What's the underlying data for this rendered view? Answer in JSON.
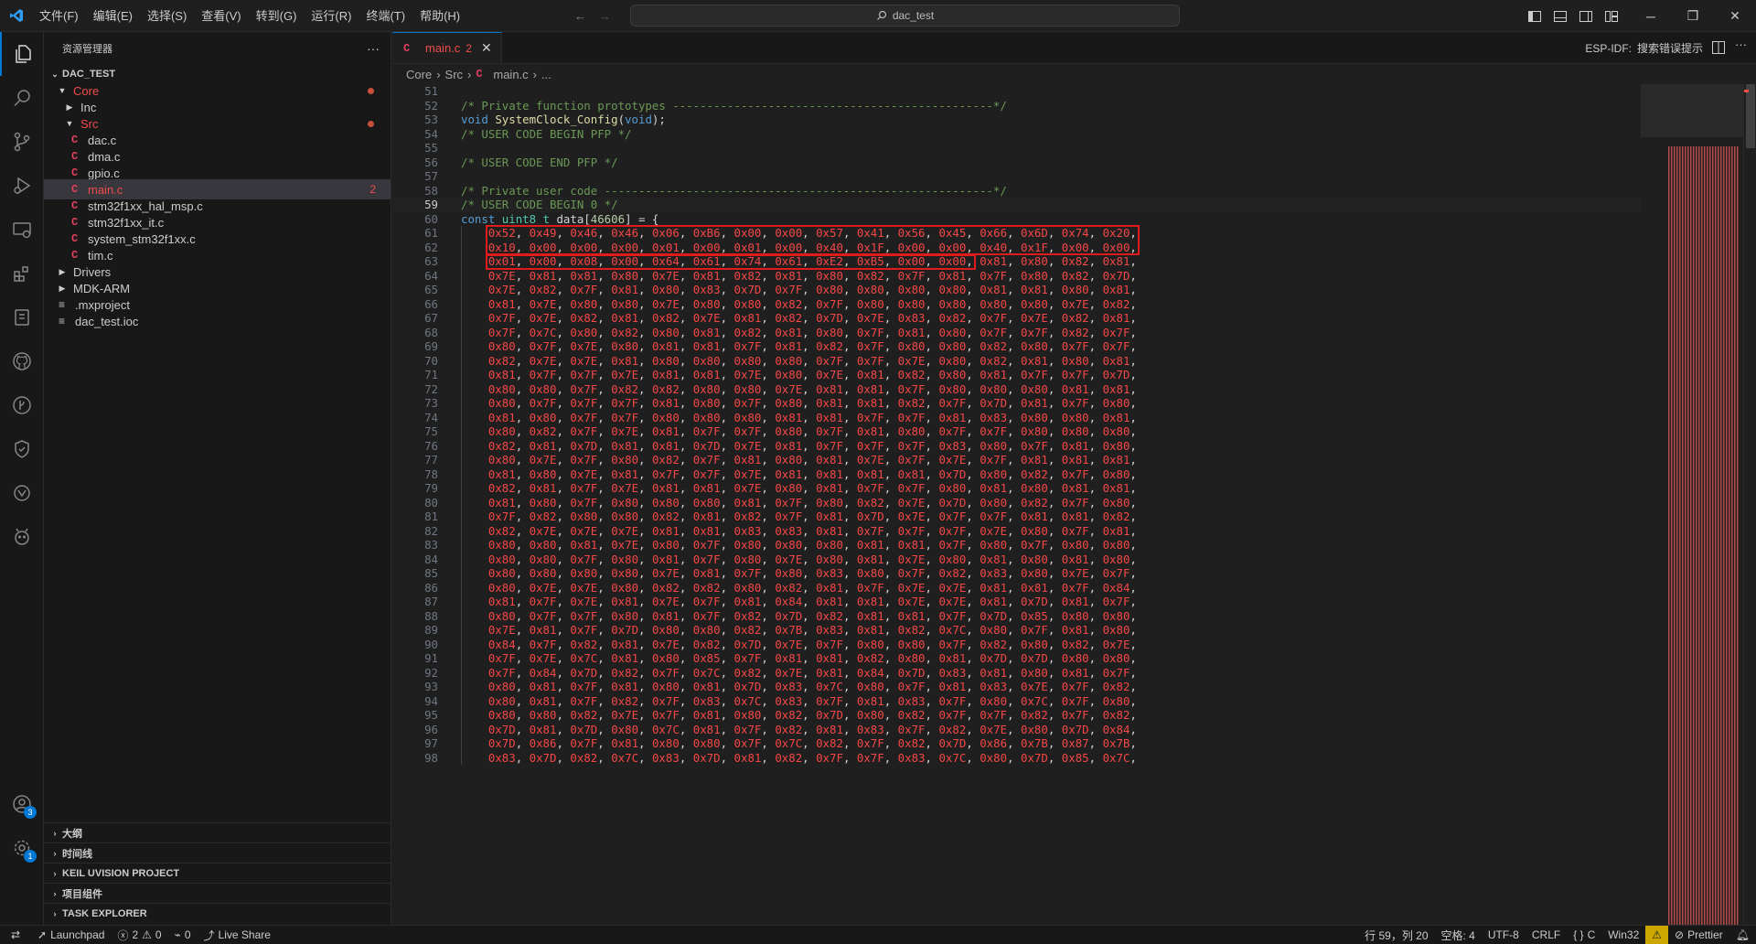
{
  "titlebar": {
    "menus": [
      "文件(F)",
      "编辑(E)",
      "选择(S)",
      "查看(V)",
      "转到(G)",
      "运行(R)",
      "终端(T)",
      "帮助(H)"
    ],
    "search_text": "dac_test"
  },
  "activity": {
    "accounts_badge": "3",
    "settings_badge": "1"
  },
  "sidebar": {
    "title": "资源管理器",
    "root": "DAC_TEST",
    "tree": {
      "core": "Core",
      "inc": "Inc",
      "src": "Src",
      "dac_c": "dac.c",
      "dma_c": "dma.c",
      "gpio_c": "gpio.c",
      "main_c": "main.c",
      "main_c_problems": "2",
      "hal_msp_c": "stm32f1xx_hal_msp.c",
      "it_c": "stm32f1xx_it.c",
      "system_c": "system_stm32f1xx.c",
      "tim_c": "tim.c",
      "drivers": "Drivers",
      "mdk_arm": "MDK-ARM",
      "mxproject": ".mxproject",
      "ioc": "dac_test.ioc"
    },
    "panels": [
      "大纲",
      "时间线",
      "KEIL UVISION PROJECT",
      "项目组件",
      "TASK EXPLORER"
    ]
  },
  "editor": {
    "tab": {
      "label": "main.c",
      "problems": "2"
    },
    "esp_idf_label": "ESP-IDF:",
    "esp_idf_action": "搜索错误提示",
    "breadcrumb": [
      "Core",
      "Src",
      "main.c",
      "..."
    ],
    "first_line_number": 51,
    "cursor_line": 59,
    "lines": [
      "",
      "/* Private function prototypes -----------------------------------------------*/",
      "void SystemClock_Config(void);",
      "/* USER CODE BEGIN PFP */",
      "",
      "/* USER CODE END PFP */",
      "",
      "/* Private user code ---------------------------------------------------------*/",
      "/* USER CODE BEGIN 0 */",
      "const uint8_t data[46606] = {",
      "    0x52, 0x49, 0x46, 0x46, 0x06, 0xB6, 0x00, 0x00, 0x57, 0x41, 0x56, 0x45, 0x66, 0x6D, 0x74, 0x20,",
      "    0x10, 0x00, 0x00, 0x00, 0x01, 0x00, 0x01, 0x00, 0x40, 0x1F, 0x00, 0x00, 0x40, 0x1F, 0x00, 0x00,",
      "    0x01, 0x00, 0x08, 0x00, 0x64, 0x61, 0x74, 0x61, 0xE2, 0xB5, 0x00, 0x00, 0x81, 0x80, 0x82, 0x81,",
      "    0x7E, 0x81, 0x81, 0x80, 0x7E, 0x81, 0x82, 0x81, 0x80, 0x82, 0x7F, 0x81, 0x7F, 0x80, 0x82, 0x7D,",
      "    0x7E, 0x82, 0x7F, 0x81, 0x80, 0x83, 0x7D, 0x7F, 0x80, 0x80, 0x80, 0x80, 0x81, 0x81, 0x80, 0x81,",
      "    0x81, 0x7E, 0x80, 0x80, 0x7E, 0x80, 0x80, 0x82, 0x7F, 0x80, 0x80, 0x80, 0x80, 0x80, 0x7E, 0x82,",
      "    0x7F, 0x7E, 0x82, 0x81, 0x82, 0x7E, 0x81, 0x82, 0x7D, 0x7E, 0x83, 0x82, 0x7F, 0x7E, 0x82, 0x81,",
      "    0x7F, 0x7C, 0x80, 0x82, 0x80, 0x81, 0x82, 0x81, 0x80, 0x7F, 0x81, 0x80, 0x7F, 0x7F, 0x82, 0x7F,",
      "    0x80, 0x7F, 0x7E, 0x80, 0x81, 0x81, 0x7F, 0x81, 0x82, 0x7F, 0x80, 0x80, 0x82, 0x80, 0x7F, 0x7F,",
      "    0x82, 0x7E, 0x7E, 0x81, 0x80, 0x80, 0x80, 0x80, 0x7F, 0x7F, 0x7E, 0x80, 0x82, 0x81, 0x80, 0x81,",
      "    0x81, 0x7F, 0x7F, 0x7E, 0x81, 0x81, 0x7E, 0x80, 0x7E, 0x81, 0x82, 0x80, 0x81, 0x7F, 0x7F, 0x7D,",
      "    0x80, 0x80, 0x7F, 0x82, 0x82, 0x80, 0x80, 0x7E, 0x81, 0x81, 0x7F, 0x80, 0x80, 0x80, 0x81, 0x81,",
      "    0x80, 0x7F, 0x7F, 0x7F, 0x81, 0x80, 0x7F, 0x80, 0x81, 0x81, 0x82, 0x7F, 0x7D, 0x81, 0x7F, 0x80,",
      "    0x81, 0x80, 0x7F, 0x7F, 0x80, 0x80, 0x80, 0x81, 0x81, 0x7F, 0x7F, 0x81, 0x83, 0x80, 0x80, 0x81,",
      "    0x80, 0x82, 0x7F, 0x7E, 0x81, 0x7F, 0x7F, 0x80, 0x7F, 0x81, 0x80, 0x7F, 0x7F, 0x80, 0x80, 0x80,",
      "    0x82, 0x81, 0x7D, 0x81, 0x81, 0x7D, 0x7E, 0x81, 0x7F, 0x7F, 0x7F, 0x83, 0x80, 0x7F, 0x81, 0x80,",
      "    0x80, 0x7E, 0x7F, 0x80, 0x82, 0x7F, 0x81, 0x80, 0x81, 0x7E, 0x7F, 0x7E, 0x7F, 0x81, 0x81, 0x81,",
      "    0x81, 0x80, 0x7E, 0x81, 0x7F, 0x7F, 0x7E, 0x81, 0x81, 0x81, 0x81, 0x7D, 0x80, 0x82, 0x7F, 0x80,",
      "    0x82, 0x81, 0x7F, 0x7E, 0x81, 0x81, 0x7E, 0x80, 0x81, 0x7F, 0x7F, 0x80, 0x81, 0x80, 0x81, 0x81,",
      "    0x81, 0x80, 0x7F, 0x80, 0x80, 0x80, 0x81, 0x7F, 0x80, 0x82, 0x7E, 0x7D, 0x80, 0x82, 0x7F, 0x80,",
      "    0x7F, 0x82, 0x80, 0x80, 0x82, 0x81, 0x82, 0x7F, 0x81, 0x7D, 0x7E, 0x7F, 0x7F, 0x81, 0x81, 0x82,",
      "    0x82, 0x7E, 0x7E, 0x7E, 0x81, 0x81, 0x83, 0x83, 0x81, 0x7F, 0x7F, 0x7F, 0x7E, 0x80, 0x7F, 0x81,",
      "    0x80, 0x80, 0x81, 0x7E, 0x80, 0x7F, 0x80, 0x80, 0x80, 0x81, 0x81, 0x7F, 0x80, 0x7F, 0x80, 0x80,",
      "    0x80, 0x80, 0x7F, 0x80, 0x81, 0x7F, 0x80, 0x7E, 0x80, 0x81, 0x7E, 0x80, 0x81, 0x80, 0x81, 0x80,",
      "    0x80, 0x80, 0x80, 0x80, 0x7E, 0x81, 0x7F, 0x80, 0x83, 0x80, 0x7F, 0x82, 0x83, 0x80, 0x7E, 0x7F,",
      "    0x80, 0x7E, 0x7E, 0x80, 0x82, 0x82, 0x80, 0x82, 0x81, 0x7F, 0x7E, 0x7E, 0x81, 0x81, 0x7F, 0x84,",
      "    0x81, 0x7F, 0x7E, 0x81, 0x7E, 0x7F, 0x81, 0x84, 0x81, 0x81, 0x7E, 0x7E, 0x81, 0x7D, 0x81, 0x7F,",
      "    0x80, 0x7F, 0x7F, 0x80, 0x81, 0x7F, 0x82, 0x7D, 0x82, 0x81, 0x81, 0x7F, 0x7D, 0x85, 0x80, 0x80,",
      "    0x7E, 0x81, 0x7F, 0x7D, 0x80, 0x80, 0x82, 0x7B, 0x83, 0x81, 0x82, 0x7C, 0x80, 0x7F, 0x81, 0x80,",
      "    0x84, 0x7F, 0x82, 0x81, 0x7E, 0x82, 0x7D, 0x7E, 0x7F, 0x80, 0x80, 0x7F, 0x82, 0x80, 0x82, 0x7E,",
      "    0x7F, 0x7E, 0x7C, 0x81, 0x80, 0x85, 0x7F, 0x81, 0x81, 0x82, 0x80, 0x81, 0x7D, 0x7D, 0x80, 0x80,",
      "    0x7F, 0x84, 0x7D, 0x82, 0x7F, 0x7C, 0x82, 0x7E, 0x81, 0x84, 0x7D, 0x83, 0x81, 0x80, 0x81, 0x7F,",
      "    0x80, 0x81, 0x7F, 0x81, 0x80, 0x81, 0x7D, 0x83, 0x7C, 0x80, 0x7F, 0x81, 0x83, 0x7E, 0x7F, 0x82,",
      "    0x80, 0x81, 0x7F, 0x82, 0x7F, 0x83, 0x7C, 0x83, 0x7F, 0x81, 0x83, 0x7F, 0x80, 0x7C, 0x7F, 0x80,",
      "    0x80, 0x80, 0x82, 0x7E, 0x7F, 0x81, 0x80, 0x82, 0x7D, 0x80, 0x82, 0x7F, 0x7F, 0x82, 0x7F, 0x82,",
      "    0x7D, 0x81, 0x7D, 0x80, 0x7C, 0x81, 0x7F, 0x82, 0x81, 0x83, 0x7F, 0x82, 0x7E, 0x80, 0x7D, 0x84,",
      "    0x7D, 0x86, 0x7F, 0x81, 0x80, 0x80, 0x7F, 0x7C, 0x82, 0x7F, 0x82, 0x7D, 0x86, 0x7B, 0x87, 0x7B,",
      "    0x83, 0x7D, 0x82, 0x7C, 0x83, 0x7D, 0x81, 0x82, 0x7F, 0x7F, 0x83, 0x7C, 0x80, 0x7D, 0x85, 0x7C,"
    ]
  },
  "statusbar": {
    "launchpad": "Launchpad",
    "errors": "2",
    "warnings": "0",
    "ports": "0",
    "liveshare": "Live Share",
    "position": "行 59，列 20",
    "spaces": "空格: 4",
    "encoding": "UTF-8",
    "eol": "CRLF",
    "language": "C",
    "platform": "Win32",
    "prettier": "Prettier"
  },
  "colors": {
    "accent": "#0078d4",
    "error": "#f14c4c",
    "highlight_box": "#e01b1b",
    "c_icon": "#e4405f"
  }
}
